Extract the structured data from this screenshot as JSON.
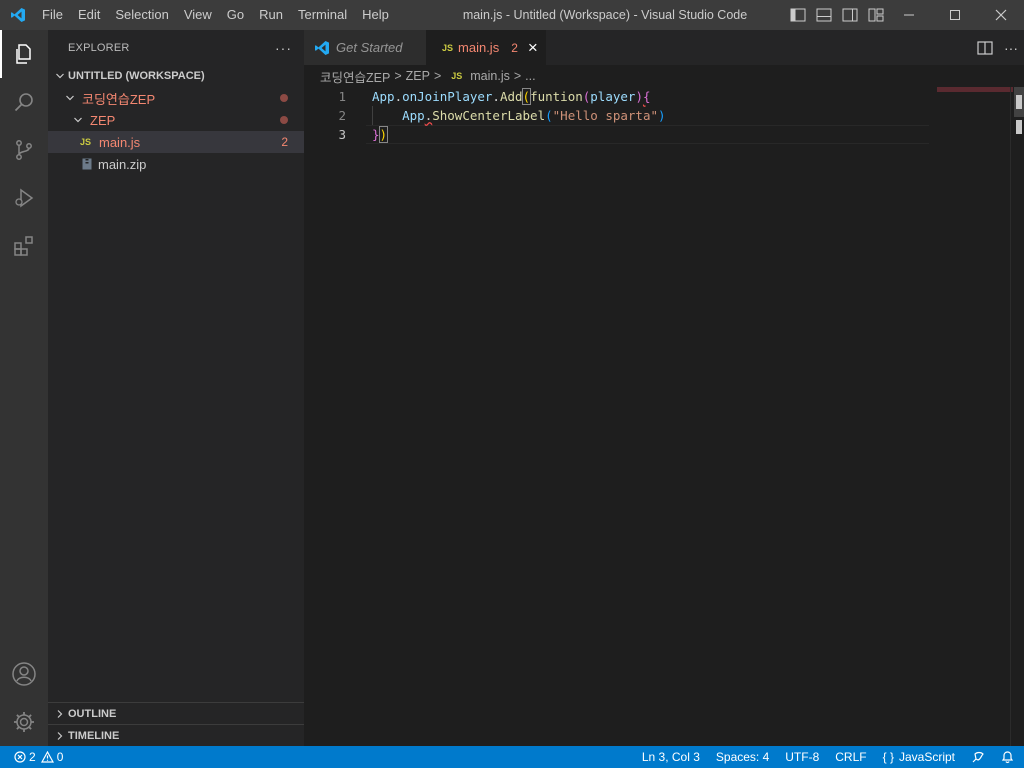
{
  "window": {
    "title": "main.js - Untitled (Workspace) - Visual Studio Code",
    "menu": [
      "File",
      "Edit",
      "Selection",
      "View",
      "Go",
      "Run",
      "Terminal",
      "Help"
    ]
  },
  "sidebar": {
    "title": "EXPLORER",
    "more": "···",
    "workspace": "UNTITLED (WORKSPACE)",
    "folder": "코딩연습ZEP",
    "subfolder": "ZEP",
    "files": [
      {
        "name": "main.js",
        "badge": "JS",
        "problems": "2"
      },
      {
        "name": "main.zip"
      }
    ],
    "outline": "OUTLINE",
    "timeline": "TIMELINE"
  },
  "tabs": [
    {
      "label": "Get Started"
    },
    {
      "label": "main.js",
      "badge": "JS",
      "problems": "2",
      "close": "×"
    }
  ],
  "tab_actions": {
    "more": "···"
  },
  "breadcrumb": {
    "items": [
      "코딩연습ZEP",
      "ZEP",
      "main.js",
      "..."
    ],
    "file_badge": "JS",
    "separator": ">"
  },
  "editor": {
    "line_numbers": [
      "1",
      "2",
      "3"
    ],
    "code": {
      "l1_obj": "App",
      "l1_dot": ".",
      "l1_method": "onJoinPlayer",
      "l1_dot2": ".",
      "l1_add": "Add",
      "l1_paren_open": "(",
      "l1_kw": "funtion",
      "l1_p2_open": "(",
      "l1_param": "player",
      "l1_p2_close": ")",
      "l1_brace": "{",
      "l2_indent": "    ",
      "l2_obj": "App",
      "l2_dot": ".",
      "l2_method": "ShowCenterLabel",
      "l2_p_open": "(",
      "l2_str": "\"Hello sparta\"",
      "l2_p_close": ")",
      "l3_brace": "}",
      "l3_paren": ")"
    }
  },
  "statusbar": {
    "errors": "2",
    "warnings": "0",
    "position": "Ln 3, Col 3",
    "spaces": "Spaces: 4",
    "encoding": "UTF-8",
    "eol": "CRLF",
    "language": "JavaScript",
    "language_icon": "{ }"
  },
  "colors": {
    "accent": "#007acc",
    "error": "#f48771",
    "js_badge": "#cbcb41"
  }
}
